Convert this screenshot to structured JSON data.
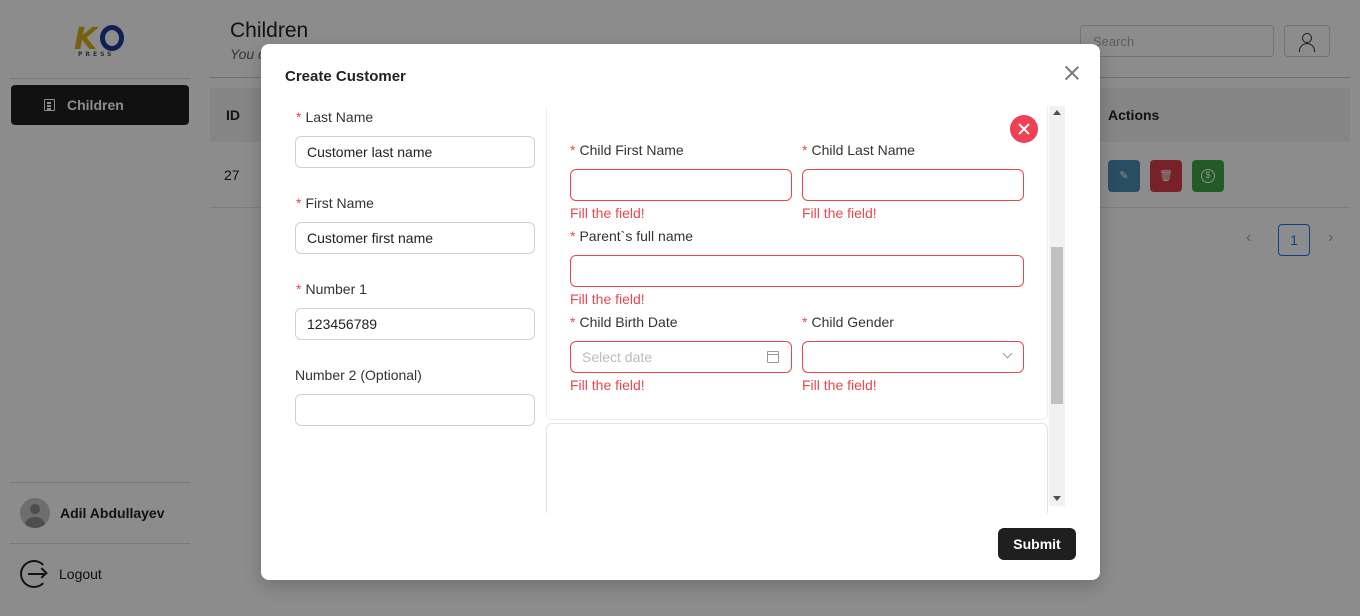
{
  "sidebar": {
    "logo_text": "KO PRESS",
    "nav_items": [
      {
        "label": "Children",
        "icon": "list-icon",
        "active": true
      }
    ],
    "user_name": "Adil Abdullayev",
    "logout_label": "Logout"
  },
  "header": {
    "title": "Children",
    "subtitle": "You c",
    "search_placeholder": "Search"
  },
  "table": {
    "columns": {
      "id": "ID",
      "actions": "Actions"
    },
    "rows": [
      {
        "id": "27"
      }
    ],
    "action_colors": {
      "edit": "#4a8fb7",
      "delete": "#d93d4a",
      "payment": "#3fa64a"
    }
  },
  "pagination": {
    "current_page": "1",
    "prev": "‹",
    "next": "›"
  },
  "modal": {
    "title": "Create Customer",
    "customer_fields": {
      "last_name": {
        "label": "Last Name",
        "required": true,
        "value": "Customer last name"
      },
      "first_name": {
        "label": "First Name",
        "required": true,
        "value": "Customer first name"
      },
      "number1": {
        "label": "Number 1",
        "required": true,
        "value": "123456789"
      },
      "number2": {
        "label": "Number 2 (Optional)",
        "required": false,
        "value": ""
      }
    },
    "child_fields": {
      "first_name": {
        "label": "Child First Name",
        "value": "",
        "error": "Fill the field!"
      },
      "last_name": {
        "label": "Child Last Name",
        "value": "",
        "error": "Fill the field!"
      },
      "parent_name": {
        "label": "Parent`s full name",
        "value": "",
        "error": "Fill the field!"
      },
      "birth_date": {
        "label": "Child Birth Date",
        "placeholder": "Select date",
        "error": "Fill the field!"
      },
      "gender": {
        "label": "Child Gender",
        "value": "",
        "error": "Fill the field!"
      }
    },
    "required_mark": "*",
    "submit_label": "Submit"
  },
  "colors": {
    "error": "#e5484d",
    "primary": "#1f1f1f",
    "remove_button": "#f04055",
    "pager_active": "#1677ff"
  }
}
